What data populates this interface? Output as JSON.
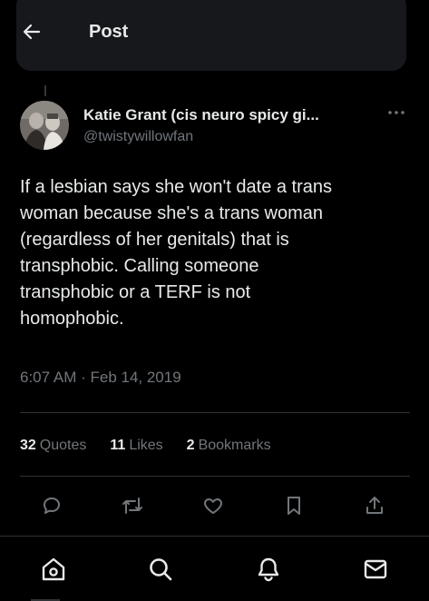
{
  "header": {
    "title": "Post",
    "back_icon": "arrow-left-icon"
  },
  "tweet": {
    "author_name": "Katie Grant (cis neuro spicy gi...",
    "author_handle": "@twistywillowfan",
    "avatar_icon": "profile-photo",
    "more_icon": "more-horizontal-icon",
    "text": "If a lesbian says she won't date a trans\nwoman because she's a trans woman\n(regardless of her genitals) that is\ntransphobic. Calling someone\ntransphobic or a TERF is not\nhomophobic.",
    "timestamp": "6:07 AM · Feb 14, 2019"
  },
  "stats": {
    "quotes_count": "32",
    "quotes_label": "Quotes",
    "likes_count": "11",
    "likes_label": "Likes",
    "bookmarks_count": "2",
    "bookmarks_label": "Bookmarks"
  },
  "actions": [
    "reply-icon",
    "retweet-icon",
    "like-icon",
    "bookmark-icon",
    "share-icon"
  ],
  "bottom_nav": [
    "home-icon",
    "search-icon",
    "notifications-icon",
    "messages-icon"
  ],
  "colors": {
    "background": "#000000",
    "primary_text": "#e7e9ea",
    "secondary_text": "#71767b",
    "divider": "#2f3336"
  }
}
